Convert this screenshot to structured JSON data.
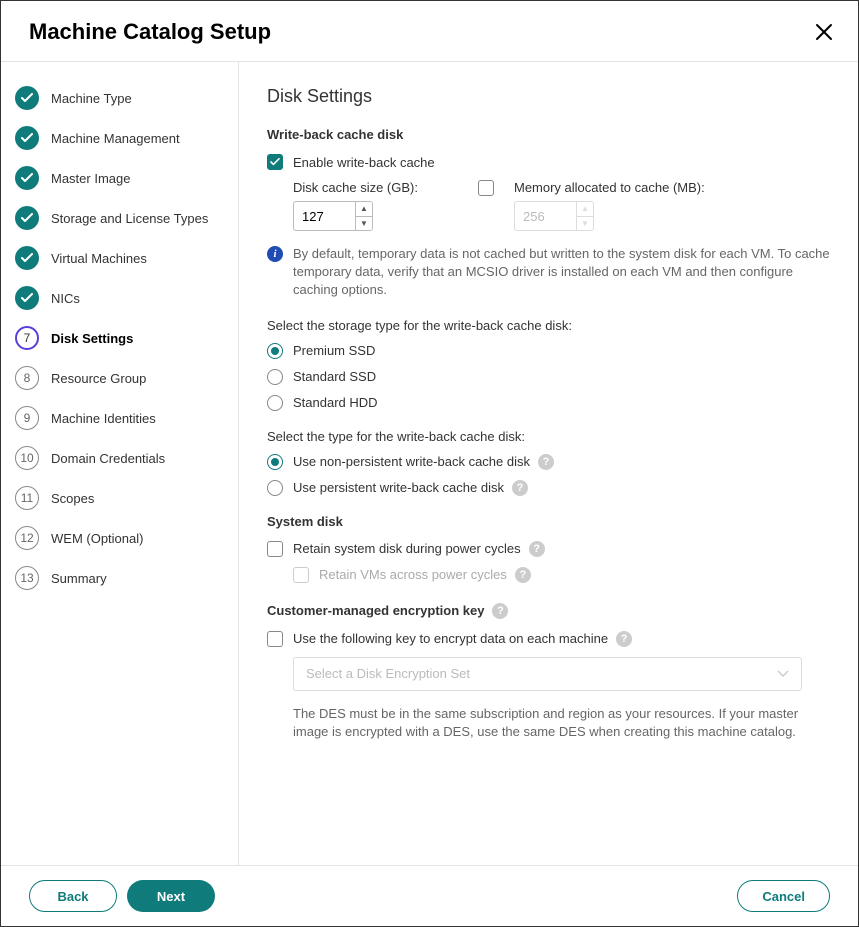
{
  "title": "Machine Catalog Setup",
  "steps": [
    {
      "label": "Machine Type",
      "state": "done"
    },
    {
      "label": "Machine Management",
      "state": "done"
    },
    {
      "label": "Master Image",
      "state": "done"
    },
    {
      "label": "Storage and License Types",
      "state": "done"
    },
    {
      "label": "Virtual Machines",
      "state": "done"
    },
    {
      "label": "NICs",
      "state": "done"
    },
    {
      "label": "Disk Settings",
      "state": "active",
      "num": "7"
    },
    {
      "label": "Resource Group",
      "state": "pending",
      "num": "8"
    },
    {
      "label": "Machine Identities",
      "state": "pending",
      "num": "9"
    },
    {
      "label": "Domain Credentials",
      "state": "pending",
      "num": "10"
    },
    {
      "label": "Scopes",
      "state": "pending",
      "num": "11"
    },
    {
      "label": "WEM (Optional)",
      "state": "pending",
      "num": "12"
    },
    {
      "label": "Summary",
      "state": "pending",
      "num": "13"
    }
  ],
  "main": {
    "heading": "Disk Settings",
    "wbc_section": "Write-back cache disk",
    "enable_wbc": "Enable write-back cache",
    "disk_cache_label": "Disk cache size (GB):",
    "disk_cache_value": "127",
    "mem_cache_label": "Memory allocated to cache (MB):",
    "mem_cache_value": "256",
    "info_text": "By default, temporary data is not cached but written to the system disk for each VM. To cache temporary data, verify that an MCSIO driver is installed on each VM and then configure caching options.",
    "storage_type_label": "Select the storage type for the write-back cache disk:",
    "storage_types": [
      "Premium SSD",
      "Standard SSD",
      "Standard HDD"
    ],
    "disk_type_label": "Select the type for the write-back cache disk:",
    "disk_types": [
      "Use non-persistent write-back cache disk",
      "Use persistent write-back cache disk"
    ],
    "system_disk_section": "System disk",
    "retain_system": "Retain system disk during power cycles",
    "retain_vms": "Retain VMs across power cycles",
    "cmek_section": "Customer-managed encryption key",
    "use_key": "Use the following key to encrypt data on each machine",
    "select_placeholder": "Select a Disk Encryption Set",
    "des_note": "The DES must be in the same subscription and region as your resources. If your master image is encrypted with a DES, use the same DES when creating this machine catalog."
  },
  "footer": {
    "back": "Back",
    "next": "Next",
    "cancel": "Cancel"
  }
}
